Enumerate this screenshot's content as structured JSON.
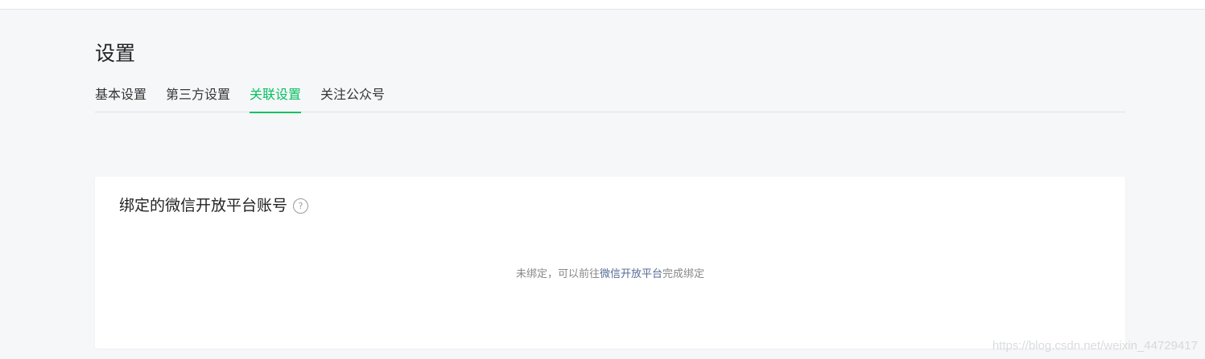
{
  "page": {
    "title": "设置"
  },
  "tabs": [
    {
      "label": "基本设置",
      "active": false
    },
    {
      "label": "第三方设置",
      "active": false
    },
    {
      "label": "关联设置",
      "active": true
    },
    {
      "label": "关注公众号",
      "active": false
    }
  ],
  "card": {
    "title": "绑定的微信开放平台账号",
    "help_icon": "question-circle-icon",
    "empty_prefix": "未绑定，可以前往",
    "empty_link": "微信开放平台",
    "empty_suffix": "完成绑定"
  },
  "watermark": "https://blog.csdn.net/weixin_44729417",
  "colors": {
    "accent": "#07c160",
    "link": "#576b95",
    "background": "#f6f7f9"
  }
}
